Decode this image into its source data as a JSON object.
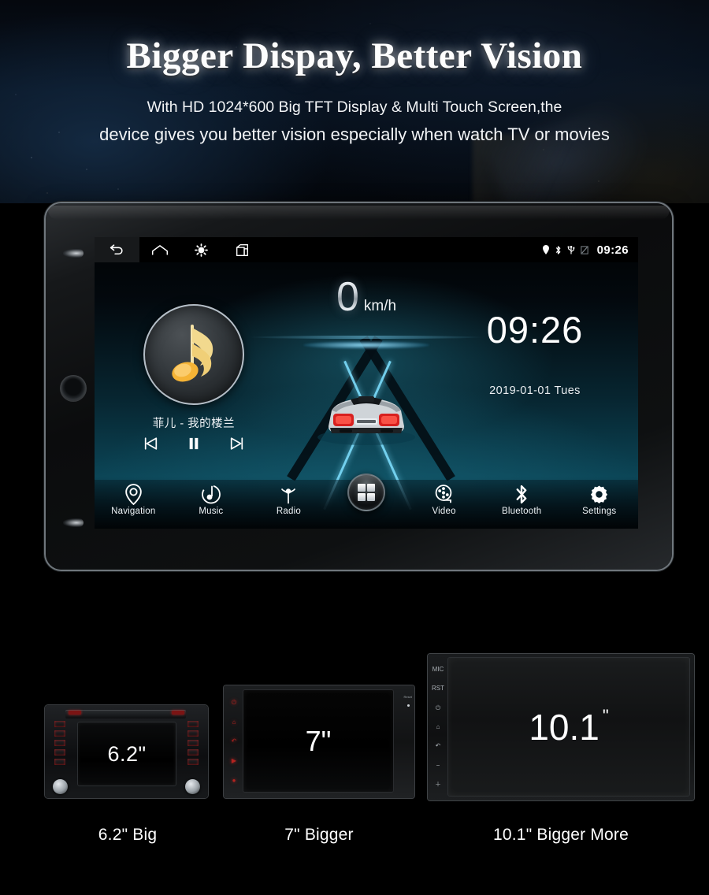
{
  "header": {
    "title": "Bigger Dispay, Better Vision",
    "subtitle_line1": "With HD 1024*600 Big TFT Display & Multi Touch Screen,the",
    "subtitle_line2": "device gives you better vision especially when watch TV or movies"
  },
  "device": {
    "statusbar": {
      "back_icon": "back-arrow-icon",
      "home_icon": "home-icon",
      "brightness_icon": "brightness-icon",
      "recents_icon": "recents-icon",
      "location_icon": "location-pin-icon",
      "bluetooth_icon": "bluetooth-icon",
      "usb_icon": "usb-icon",
      "sd_icon": "sd-card-icon",
      "time": "09:26"
    },
    "speed": {
      "value": "0",
      "unit": "km/h"
    },
    "music": {
      "art_icon": "music-note-icon",
      "track": "菲儿 - 我的楼兰",
      "prev_icon": "previous-track-icon",
      "pause_icon": "pause-icon",
      "next_icon": "next-track-icon"
    },
    "clock": {
      "time": "09:26",
      "date": "2019-01-01  Tues"
    },
    "dock": {
      "apps_icon": "apps-grid-icon",
      "items": [
        {
          "label": "Navigation",
          "icon": "location-pin-icon"
        },
        {
          "label": "Music",
          "icon": "music-note-icon"
        },
        {
          "label": "Radio",
          "icon": "radio-antenna-icon"
        },
        {
          "label": "Video",
          "icon": "film-reel-icon"
        },
        {
          "label": "Bluetooth",
          "icon": "bluetooth-icon"
        },
        {
          "label": "Settings",
          "icon": "gear-icon"
        }
      ]
    }
  },
  "comparison": {
    "units": [
      {
        "screen_size": "6.2\"",
        "caption": "6.2\" Big"
      },
      {
        "screen_size": "7\"",
        "caption": "7\" Bigger"
      },
      {
        "screen_size": "10.1",
        "size_sup": "\"",
        "caption": "10.1\" Bigger More"
      }
    ],
    "unit7_side_labels": [
      "⏻",
      "⌂",
      "↶",
      "▶",
      "●"
    ],
    "unit7_reset_label": "Reset",
    "unit101_side_labels": [
      "MIC",
      "RST",
      "⏻",
      "⌂",
      "↶",
      "−",
      "＋"
    ]
  },
  "colors": {
    "accent_teal": "#1e6e82",
    "lane_blue": "#78d7f5",
    "music_gold": "#f5b335",
    "background": "#000000"
  }
}
